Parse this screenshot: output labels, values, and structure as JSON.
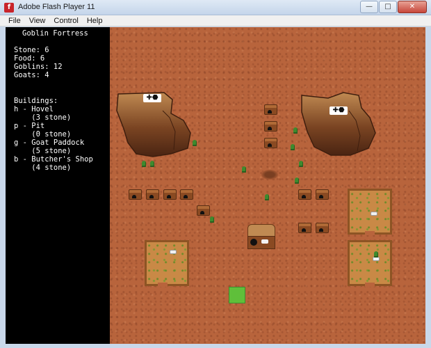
{
  "window": {
    "title": "Adobe Flash Player 11",
    "controls": {
      "minimize": "—",
      "maximize": "□",
      "close": "✕"
    }
  },
  "menu": [
    "File",
    "View",
    "Control",
    "Help"
  ],
  "panel": {
    "title": "Goblin Fortress",
    "stats": [
      "Stone: 6",
      "Food: 6",
      "Goblins: 12",
      "Goats: 4"
    ],
    "buildings_header": "Buildings:",
    "buildings": [
      "h - Hovel",
      "    (3 stone)",
      "p - Pit",
      "    (0 stone)",
      "g - Goat Paddock",
      "    (5 stone)",
      "b - Butcher's Shop",
      "    (4 stone)"
    ]
  },
  "colors": {
    "ground": "#b8643c",
    "goblin": "#3e8a2e",
    "selection_cursor": "#5fbf3a",
    "panel_bg": "#000000"
  },
  "icons": [
    "flash-app-icon",
    "goblin-sprite",
    "goat-sprite",
    "hovel-sprite",
    "mountain-sprite",
    "paddock-sprite",
    "butcher-shop-sprite",
    "stone-deposit-icon"
  ]
}
